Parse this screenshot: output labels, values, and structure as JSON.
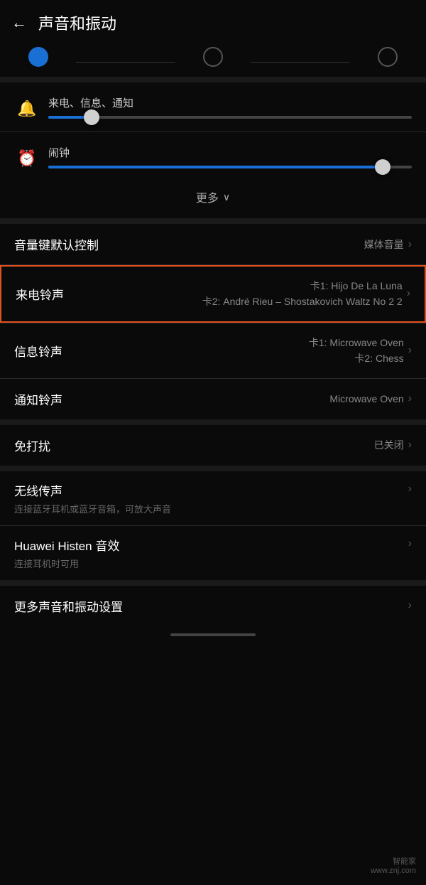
{
  "header": {
    "back_label": "←",
    "title": "声音和振动"
  },
  "tabs": [
    {
      "state": "active"
    },
    {
      "state": "inactive"
    },
    {
      "state": "inactive"
    }
  ],
  "volume_section": {
    "ringtone_label": "来电、信息、通知",
    "alarm_label": "闹钟"
  },
  "more_row": {
    "label": "更多",
    "chevron": "∨"
  },
  "list_rows": [
    {
      "label": "音量键默认控制",
      "value": "媒体音量",
      "arrow": "›"
    }
  ],
  "ringtone_row": {
    "label": "来电铃声",
    "card1_value": "卡1: Hijo De La Luna",
    "card2_value": "卡2: André Rieu – Shostakovich Waltz No 2 2",
    "arrow": "›"
  },
  "message_row": {
    "label": "信息铃声",
    "card1_value": "卡1: Microwave Oven",
    "card2_value": "卡2: Chess",
    "arrow": "›"
  },
  "notification_row": {
    "label": "通知铃声",
    "value": "Microwave Oven",
    "arrow": "›"
  },
  "dnd_row": {
    "label": "免打扰",
    "value": "已关闭",
    "arrow": "›"
  },
  "wireless_rows": [
    {
      "label": "无线传声",
      "sub": "连接蓝牙耳机或蓝牙音箱，可放大声音",
      "arrow": "›"
    },
    {
      "label": "Huawei Histen 音效",
      "sub": "连接耳机时可用",
      "arrow": "›"
    }
  ],
  "more_settings_row": {
    "label": "更多声音和振动设置",
    "arrow": "›"
  },
  "watermark": {
    "line1": "智能家",
    "line2": "www.znj.com"
  }
}
